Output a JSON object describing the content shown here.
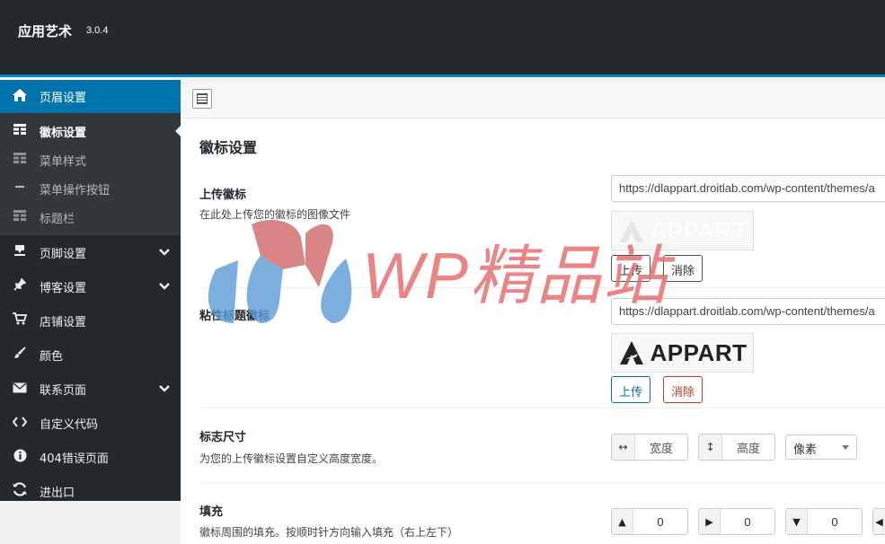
{
  "app": {
    "title": "应用艺术",
    "version": "3.0.4"
  },
  "sidebar": {
    "active_section": {
      "label": "页眉设置",
      "icon": "home-icon"
    },
    "submenu": [
      {
        "label": "徽标设置",
        "icon": "grid-icon",
        "current": true
      },
      {
        "label": "菜单样式",
        "icon": "grid-icon"
      },
      {
        "label": "菜单操作按钮",
        "icon": "minus-icon"
      },
      {
        "label": "标题栏",
        "icon": "grid-icon"
      }
    ],
    "sections": [
      {
        "label": "页脚设置",
        "icon": "download-icon",
        "expandable": true
      },
      {
        "label": "博客设置",
        "icon": "pin-icon",
        "expandable": true
      },
      {
        "label": "店铺设置",
        "icon": "cart-icon",
        "expandable": false
      },
      {
        "label": "颜色",
        "icon": "brush-icon",
        "expandable": false
      },
      {
        "label": "联系页面",
        "icon": "mail-icon",
        "expandable": true
      },
      {
        "label": "自定义代码",
        "icon": "code-icon",
        "expandable": false
      },
      {
        "label": "404错误页面",
        "icon": "info-icon",
        "expandable": false
      },
      {
        "label": "进出口",
        "icon": "refresh-icon",
        "expandable": false
      }
    ]
  },
  "toolbar": {
    "layout_icon": "layout-toggle-icon"
  },
  "main": {
    "section_title": "徽标设置",
    "upload_logo": {
      "label": "上传徽标",
      "desc": "在此处上传您的徽标的图像文件",
      "url": "https://dlappart.droitlab.com/wp-content/themes/a",
      "preview_text": "APPART",
      "upload_label": "上传",
      "remove_label": "消除"
    },
    "sticky_logo": {
      "label": "粘性标题徽标",
      "url": "https://dlappart.droitlab.com/wp-content/themes/a",
      "preview_text": "APPART",
      "upload_label": "上传",
      "remove_label": "消除"
    },
    "logo_size": {
      "label": "标志尺寸",
      "desc": "为您的上传徽标设置自定义高度宽度。",
      "width_placeholder": "宽度",
      "height_placeholder": "高度",
      "unit": "像素"
    },
    "padding": {
      "label": "填充",
      "desc": "徽标周围的填充。按顺时针方向输入填充（右上左下）",
      "top": "0",
      "right": "0",
      "bottom": "0",
      "left": ""
    }
  },
  "watermark": {
    "text": "WP精品站"
  },
  "colors": {
    "sidebar_bg": "#23282d",
    "accent": "#0073aa",
    "remove": "#c0392b",
    "watermark_red": "#e86e6e",
    "watermark_blue": "#5b9bd5"
  }
}
